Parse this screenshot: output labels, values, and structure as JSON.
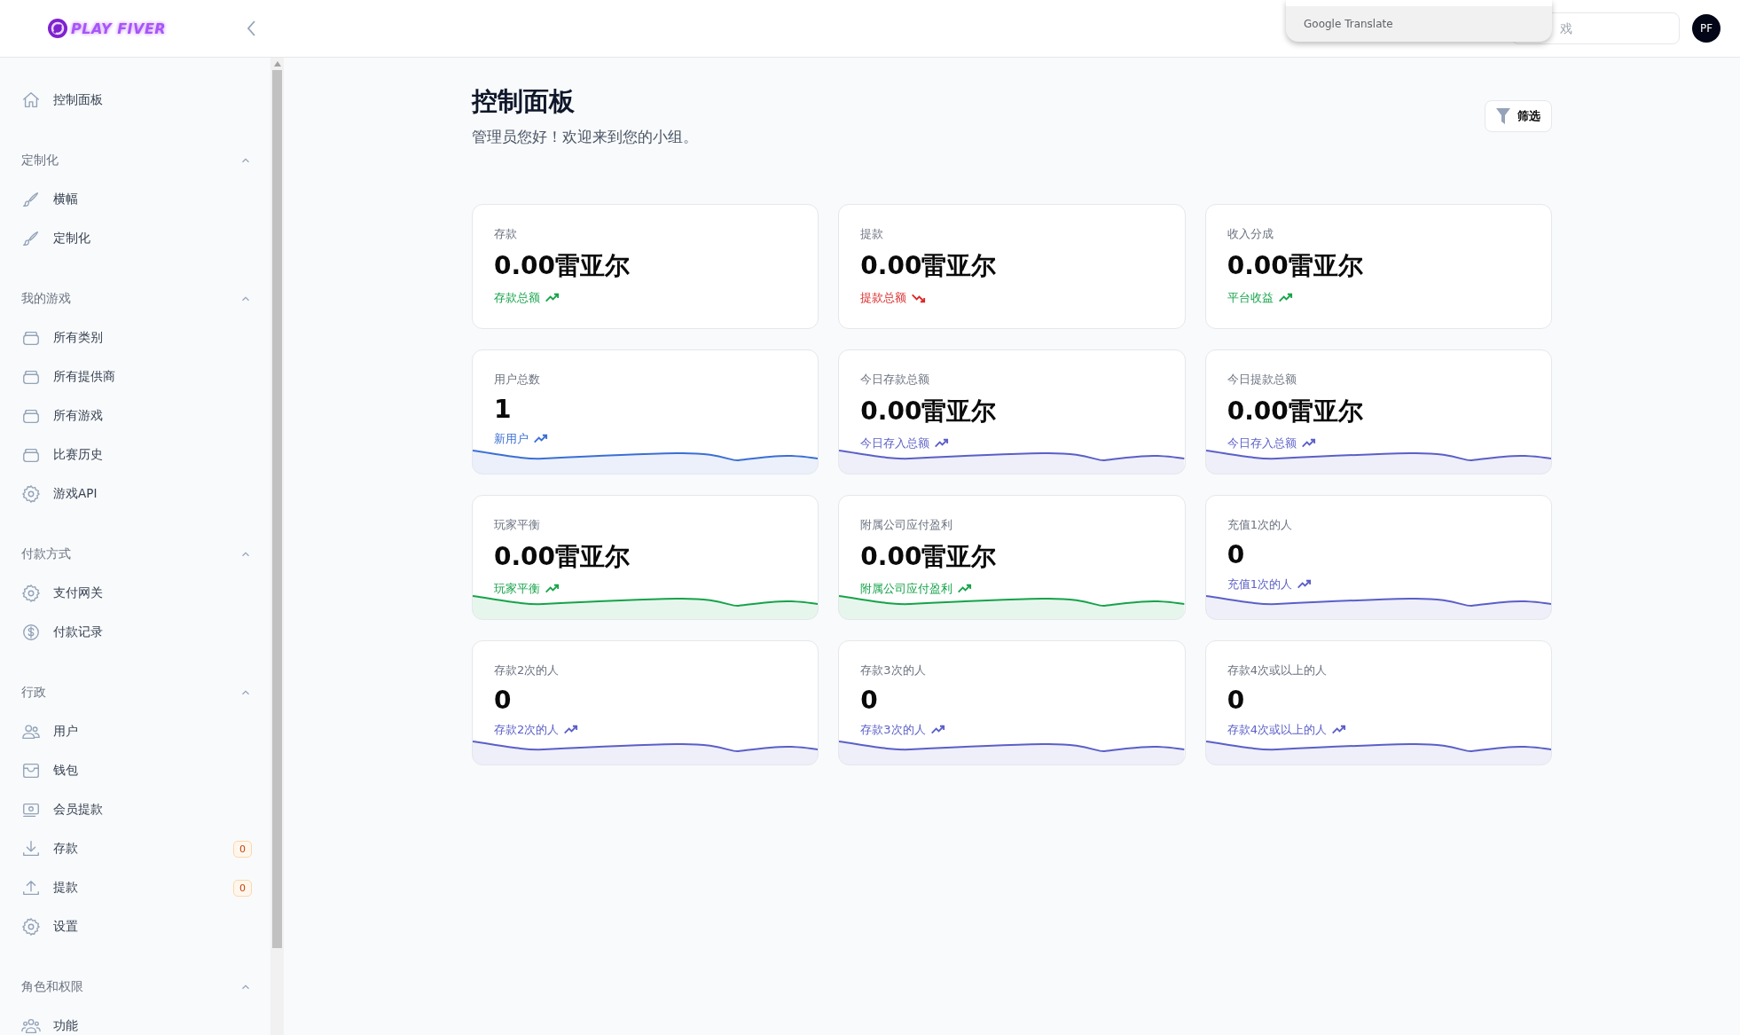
{
  "header": {
    "logo": "PLAY FIVER",
    "search": {
      "placeholder": "戏"
    },
    "avatar": "PF",
    "translate_popup": {
      "label": "Google Translate"
    }
  },
  "sidebar": {
    "sections": [
      {
        "items": [
          {
            "label": "控制面板"
          }
        ]
      },
      {
        "title": "定制化",
        "expanded": true,
        "items": [
          {
            "label": "横幅"
          },
          {
            "label": "定制化"
          }
        ]
      },
      {
        "title": "我的游戏",
        "expanded": true,
        "items": [
          {
            "label": "所有类别"
          },
          {
            "label": "所有提供商"
          },
          {
            "label": "所有游戏"
          },
          {
            "label": "比赛历史"
          },
          {
            "label": "游戏API"
          }
        ]
      },
      {
        "title": "付款方式",
        "expanded": true,
        "items": [
          {
            "label": "支付网关"
          },
          {
            "label": "付款记录"
          }
        ]
      },
      {
        "title": "行政",
        "expanded": true,
        "items": [
          {
            "label": "用户"
          },
          {
            "label": "钱包"
          },
          {
            "label": "会员提款"
          },
          {
            "label": "存款",
            "badge": "0"
          },
          {
            "label": "提款",
            "badge": "0"
          },
          {
            "label": "设置"
          }
        ]
      },
      {
        "title": "角色和权限",
        "expanded": true,
        "items": [
          {
            "label": "功能"
          }
        ]
      }
    ]
  },
  "page": {
    "title": "控制面板",
    "subtitle": "管理员您好！欢迎来到您的小组。",
    "filter_button": "筛选"
  },
  "cards": [
    {
      "label": "存款",
      "value": "0.00雷亚尔",
      "caption": "存款总额",
      "kind": "up",
      "color": "#16a34a",
      "sparkline": false
    },
    {
      "label": "提款",
      "value": "0.00雷亚尔",
      "caption": "提款总额",
      "kind": "down",
      "color": "#dc2626",
      "sparkline": false
    },
    {
      "label": "收入分成",
      "value": "0.00雷亚尔",
      "caption": "平台收益",
      "kind": "up",
      "color": "#16a34a",
      "sparkline": false
    },
    {
      "label": "用户总数",
      "value": "1",
      "caption": "新用户",
      "kind": "up",
      "color": "#3b6fd4",
      "sparkline": true
    },
    {
      "label": "今日存款总额",
      "value": "0.00雷亚尔",
      "caption": "今日存入总额",
      "kind": "up",
      "color": "#5b5fc7",
      "sparkline": true
    },
    {
      "label": "今日提款总额",
      "value": "0.00雷亚尔",
      "caption": "今日存入总额",
      "kind": "up",
      "color": "#5b5fc7",
      "sparkline": true
    },
    {
      "label": "玩家平衡",
      "value": "0.00雷亚尔",
      "caption": "玩家平衡",
      "kind": "up",
      "color": "#16a34a",
      "sparkline": true
    },
    {
      "label": "附属公司应付盈利",
      "value": "0.00雷亚尔",
      "caption": "附属公司应付盈利",
      "kind": "up",
      "color": "#16a34a",
      "sparkline": true
    },
    {
      "label": "充值1次的人",
      "value": "0",
      "caption": "充值1次的人",
      "kind": "up",
      "color": "#5b5fc7",
      "sparkline": true
    },
    {
      "label": "存款2次的人",
      "value": "0",
      "caption": "存款2次的人",
      "kind": "up",
      "color": "#5b5fc7",
      "sparkline": true
    },
    {
      "label": "存款3次的人",
      "value": "0",
      "caption": "存款3次的人",
      "kind": "up",
      "color": "#5b5fc7",
      "sparkline": true
    },
    {
      "label": "存款4次或以上的人",
      "value": "0",
      "caption": "存款4次或以上的人",
      "kind": "up",
      "color": "#5b5fc7",
      "sparkline": true
    }
  ]
}
